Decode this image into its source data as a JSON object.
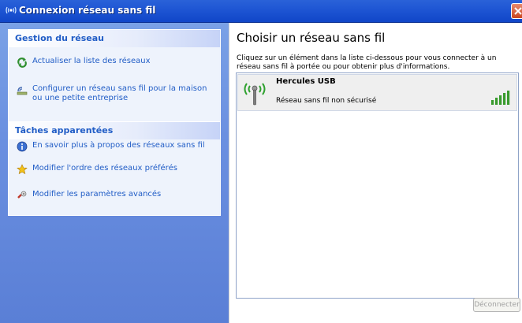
{
  "window": {
    "title": "Connexion réseau sans fil",
    "icon": "wireless-icon",
    "close_icon": "close-icon"
  },
  "network_tasks": {
    "title": "Gestion du réseau",
    "items": [
      {
        "label": "Actualiser la liste des réseaux",
        "icon": "refresh-icon"
      },
      {
        "label": "Configurer un réseau sans fil pour la maison ou une petite entreprise",
        "icon": "wizard-icon"
      }
    ]
  },
  "related_tasks": {
    "title": "Tâches apparentées",
    "items": [
      {
        "label": "En savoir plus à propos des réseaux sans fil",
        "icon": "info-icon"
      },
      {
        "label": "Modifier l'ordre des réseaux préférés",
        "icon": "star-icon"
      },
      {
        "label": "Modifier les paramètres avancés",
        "icon": "settings-icon"
      }
    ]
  },
  "main": {
    "heading": "Choisir un réseau sans fil",
    "instructions": "Cliquez sur un élément dans la liste ci-dessous pour vous connecter à un réseau sans fil à portée ou pour obtenir plus d'informations.",
    "networks": [
      {
        "name": "Hercules USB",
        "status": "Réseau sans fil non sécurisé",
        "signal_bars": 5,
        "icon": "antenna-icon"
      }
    ],
    "disconnect_label": "Déconnecter"
  },
  "colors": {
    "titlebar": "#1f56d4",
    "pane": "#6a8fe0",
    "link": "#215dc6",
    "signal": "#3a9b2e"
  }
}
